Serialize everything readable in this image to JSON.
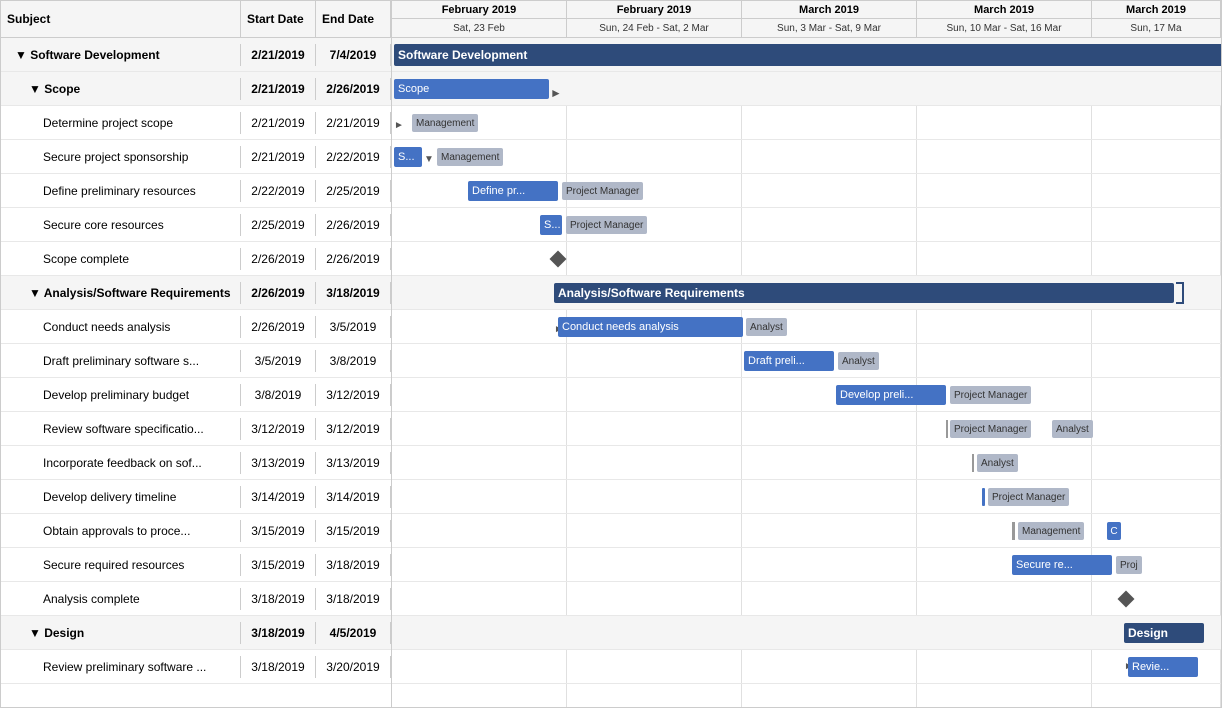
{
  "header": {
    "columns": {
      "subject": "Subject",
      "start_date": "Start Date",
      "end_date": "End Date"
    },
    "months": [
      {
        "label": "February 2019",
        "span_weeks": 2
      },
      {
        "label": "February 2019",
        "span_weeks": 2
      },
      {
        "label": "March 2019",
        "span_weeks": 2
      }
    ],
    "weeks": [
      "Sat, 23 Feb",
      "Sun, 24 Feb - Sat, 2 Mar",
      "Sun, 3 Mar - Sat, 9 Mar",
      "Sun, 10 Mar - Sat, 16 Mar",
      "Sun, 17 Ma"
    ]
  },
  "rows": [
    {
      "id": 1,
      "level": 1,
      "group": true,
      "subject": "▼ Software Development",
      "start": "2/21/2019",
      "end": "7/4/2019"
    },
    {
      "id": 2,
      "level": 2,
      "group": true,
      "subject": "▼ Scope",
      "start": "2/21/2019",
      "end": "2/26/2019"
    },
    {
      "id": 3,
      "level": 3,
      "group": false,
      "subject": "Determine project scope",
      "start": "2/21/2019",
      "end": "2/21/2019"
    },
    {
      "id": 4,
      "level": 3,
      "group": false,
      "subject": "Secure project sponsorship",
      "start": "2/21/2019",
      "end": "2/22/2019"
    },
    {
      "id": 5,
      "level": 3,
      "group": false,
      "subject": "Define preliminary resources",
      "start": "2/22/2019",
      "end": "2/25/2019"
    },
    {
      "id": 6,
      "level": 3,
      "group": false,
      "subject": "Secure core resources",
      "start": "2/25/2019",
      "end": "2/26/2019"
    },
    {
      "id": 7,
      "level": 3,
      "group": false,
      "subject": "Scope complete",
      "start": "2/26/2019",
      "end": "2/26/2019"
    },
    {
      "id": 8,
      "level": 2,
      "group": true,
      "subject": "▼ Analysis/Software Requirements",
      "start": "2/26/2019",
      "end": "3/18/2019"
    },
    {
      "id": 9,
      "level": 3,
      "group": false,
      "subject": "Conduct needs analysis",
      "start": "2/26/2019",
      "end": "3/5/2019"
    },
    {
      "id": 10,
      "level": 3,
      "group": false,
      "subject": "Draft preliminary software s...",
      "start": "3/5/2019",
      "end": "3/8/2019"
    },
    {
      "id": 11,
      "level": 3,
      "group": false,
      "subject": "Develop preliminary budget",
      "start": "3/8/2019",
      "end": "3/12/2019"
    },
    {
      "id": 12,
      "level": 3,
      "group": false,
      "subject": "Review software specificatio...",
      "start": "3/12/2019",
      "end": "3/12/2019"
    },
    {
      "id": 13,
      "level": 3,
      "group": false,
      "subject": "Incorporate feedback on sof...",
      "start": "3/13/2019",
      "end": "3/13/2019"
    },
    {
      "id": 14,
      "level": 3,
      "group": false,
      "subject": "Develop delivery timeline",
      "start": "3/14/2019",
      "end": "3/14/2019"
    },
    {
      "id": 15,
      "level": 3,
      "group": false,
      "subject": "Obtain approvals to proce...",
      "start": "3/15/2019",
      "end": "3/15/2019"
    },
    {
      "id": 16,
      "level": 3,
      "group": false,
      "subject": "Secure required resources",
      "start": "3/15/2019",
      "end": "3/18/2019"
    },
    {
      "id": 17,
      "level": 3,
      "group": false,
      "subject": "Analysis complete",
      "start": "3/18/2019",
      "end": "3/18/2019"
    },
    {
      "id": 18,
      "level": 2,
      "group": true,
      "subject": "▼ Design",
      "start": "3/18/2019",
      "end": "4/5/2019"
    },
    {
      "id": 19,
      "level": 3,
      "group": false,
      "subject": "Review preliminary software ...",
      "start": "3/18/2019",
      "end": "3/20/2019"
    }
  ],
  "colors": {
    "dark_blue": "#2E4B7A",
    "medium_blue": "#4472C4",
    "light_blue": "#70A0D4",
    "resource_tag": "#b0b8c8",
    "milestone": "#666666",
    "group_bg": "#f5f5f5"
  }
}
